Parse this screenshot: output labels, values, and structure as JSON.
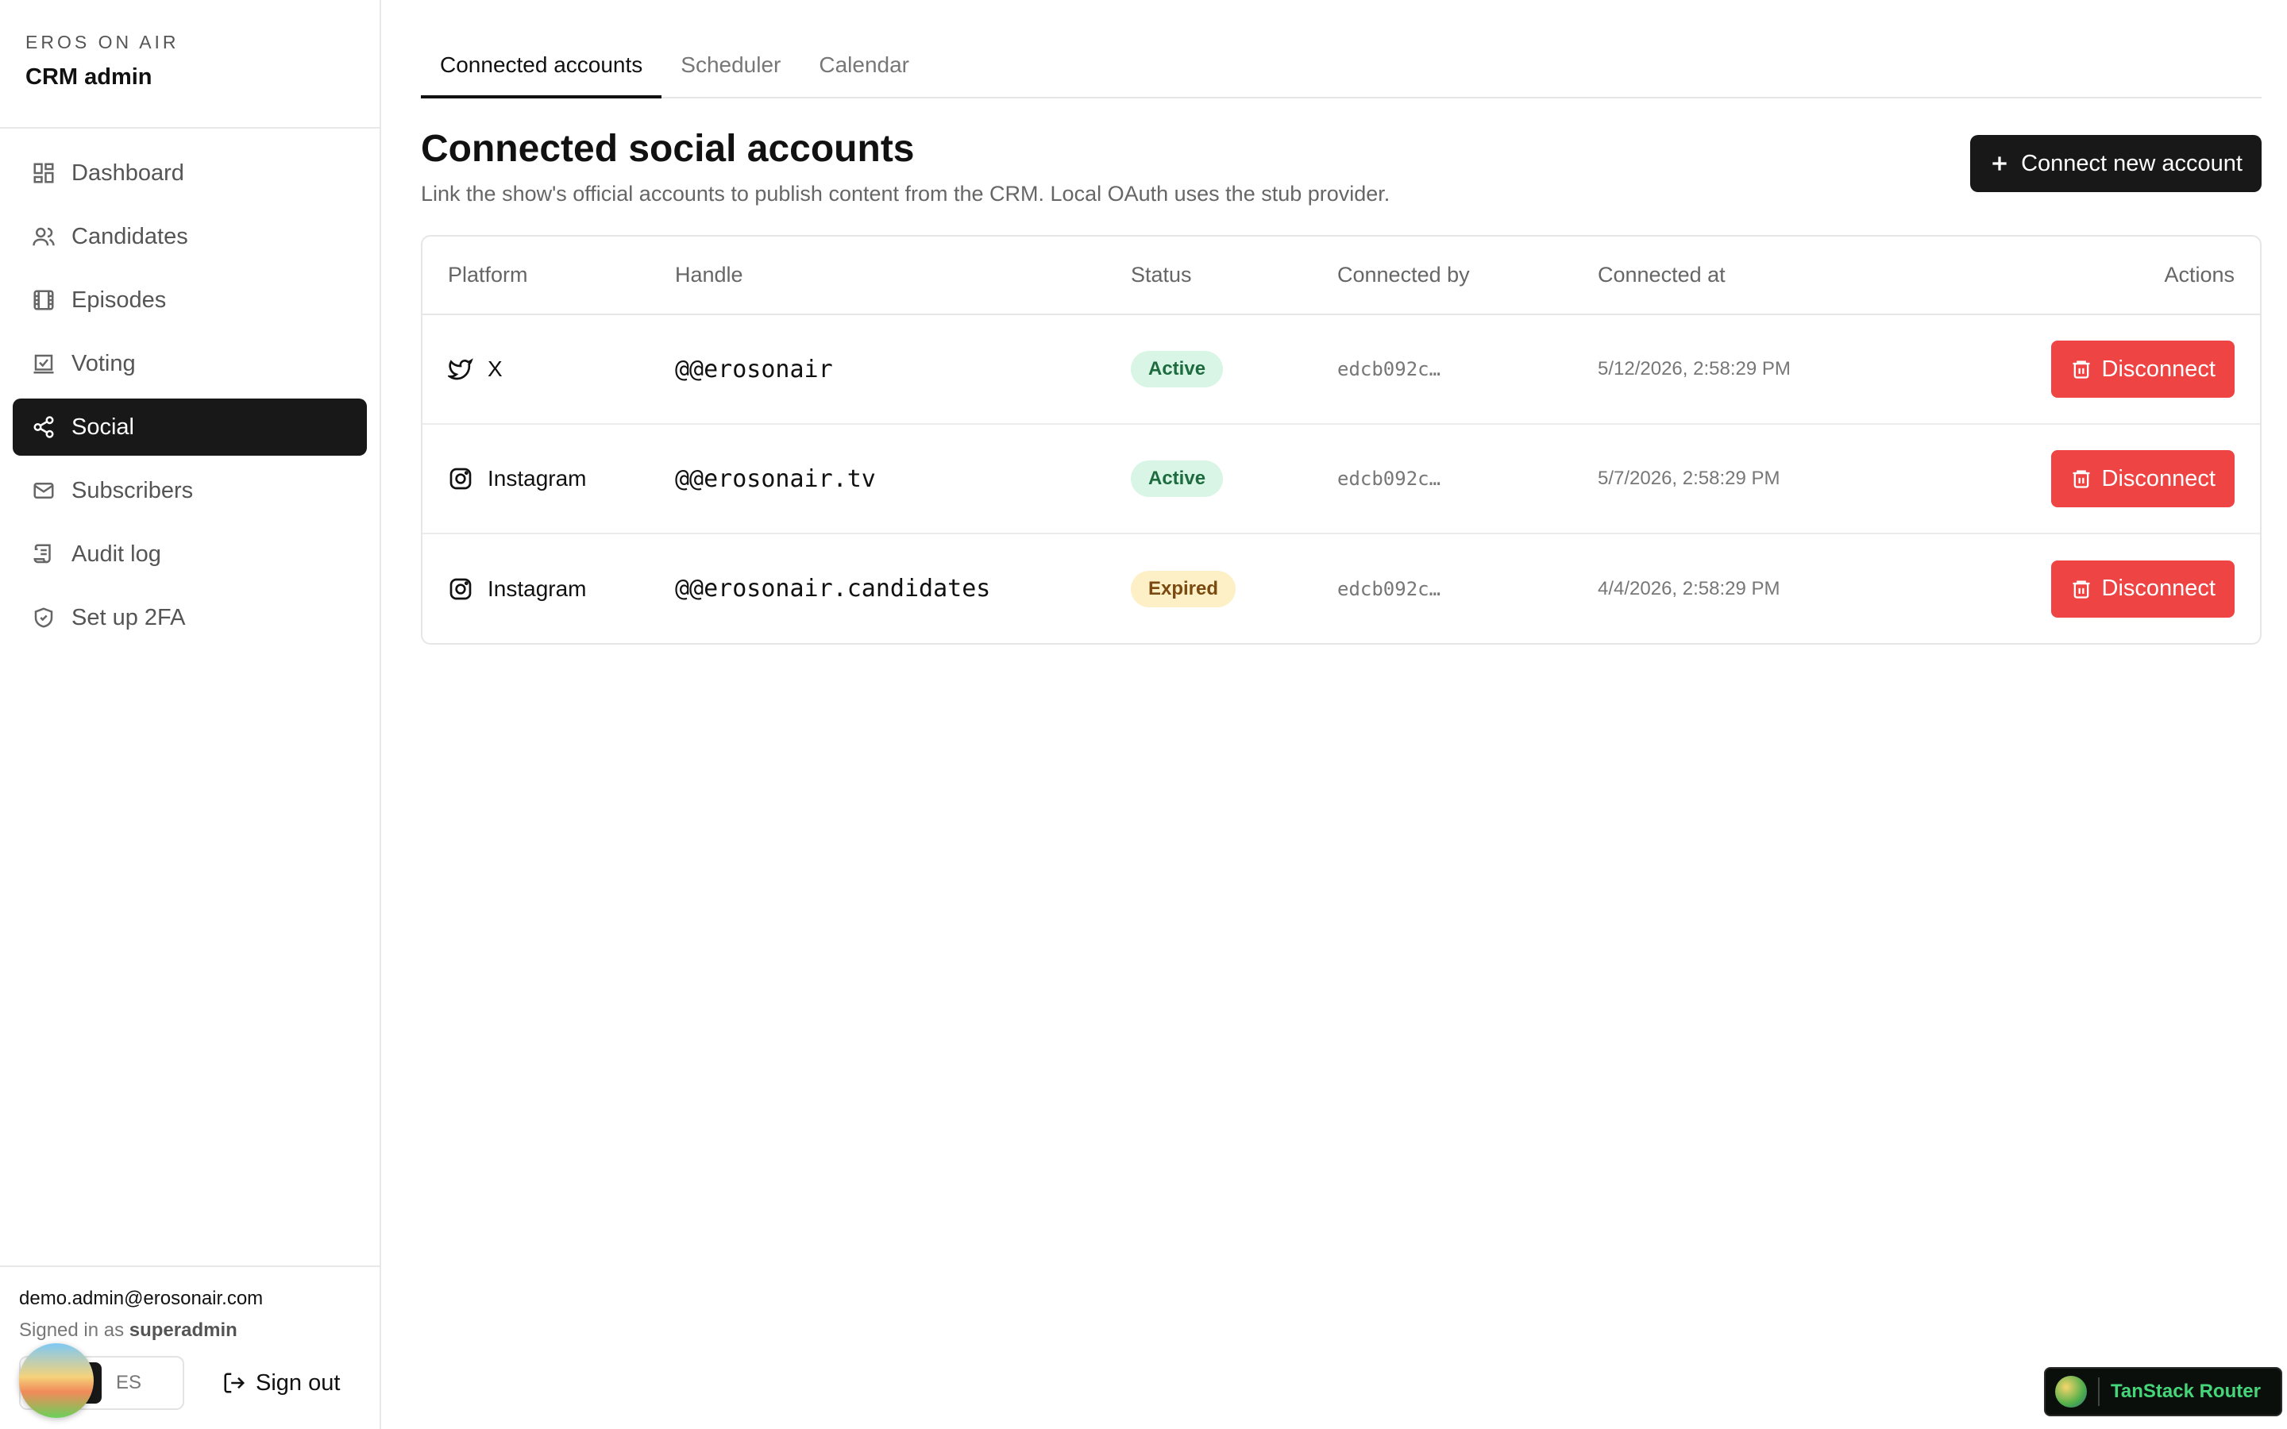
{
  "sidebar": {
    "brand_kicker": "EROS ON AIR",
    "brand_title": "CRM admin",
    "items": [
      {
        "label": "Dashboard",
        "icon": "dashboard-icon",
        "active": false
      },
      {
        "label": "Candidates",
        "icon": "users-icon",
        "active": false
      },
      {
        "label": "Episodes",
        "icon": "film-icon",
        "active": false
      },
      {
        "label": "Voting",
        "icon": "vote-icon",
        "active": false
      },
      {
        "label": "Social",
        "icon": "share-icon",
        "active": true
      },
      {
        "label": "Subscribers",
        "icon": "mail-icon",
        "active": false
      },
      {
        "label": "Audit log",
        "icon": "scroll-icon",
        "active": false
      },
      {
        "label": "Set up 2FA",
        "icon": "shield-icon",
        "active": false
      }
    ],
    "footer": {
      "email": "demo.admin@erosonair.com",
      "role_prefix": "Signed in as",
      "role": "superadmin",
      "lang_en": "N",
      "lang_es": "ES",
      "sign_out": "Sign out"
    }
  },
  "tabs": [
    {
      "label": "Connected accounts",
      "active": true
    },
    {
      "label": "Scheduler",
      "active": false
    },
    {
      "label": "Calendar",
      "active": false
    }
  ],
  "page": {
    "title": "Connected social accounts",
    "subtitle": "Link the show's official accounts to publish content from the CRM. Local OAuth uses the stub provider.",
    "connect_button": "Connect new account"
  },
  "table": {
    "headers": [
      "Platform",
      "Handle",
      "Status",
      "Connected by",
      "Connected at",
      "Actions"
    ],
    "rows": [
      {
        "platform": "X",
        "platform_icon": "twitter-bird-icon",
        "handle": "@@erosonair",
        "status": "Active",
        "status_kind": "active",
        "connected_by": "edcb092c…",
        "connected_at": "5/12/2026, 2:58:29 PM",
        "action": "Disconnect"
      },
      {
        "platform": "Instagram",
        "platform_icon": "instagram-icon",
        "handle": "@@erosonair.tv",
        "status": "Active",
        "status_kind": "active",
        "connected_by": "edcb092c…",
        "connected_at": "5/7/2026, 2:58:29 PM",
        "action": "Disconnect"
      },
      {
        "platform": "Instagram",
        "platform_icon": "instagram-icon",
        "handle": "@@erosonair.candidates",
        "status": "Expired",
        "status_kind": "expired",
        "connected_by": "edcb092c…",
        "connected_at": "4/4/2026, 2:58:29 PM",
        "action": "Disconnect"
      }
    ]
  },
  "devtools": {
    "label": "TanStack Router"
  },
  "colors": {
    "accent_dark": "#181818",
    "danger": "#ef4444",
    "active_badge": "#d9f5e5",
    "expired_badge": "#fdf0c7"
  }
}
